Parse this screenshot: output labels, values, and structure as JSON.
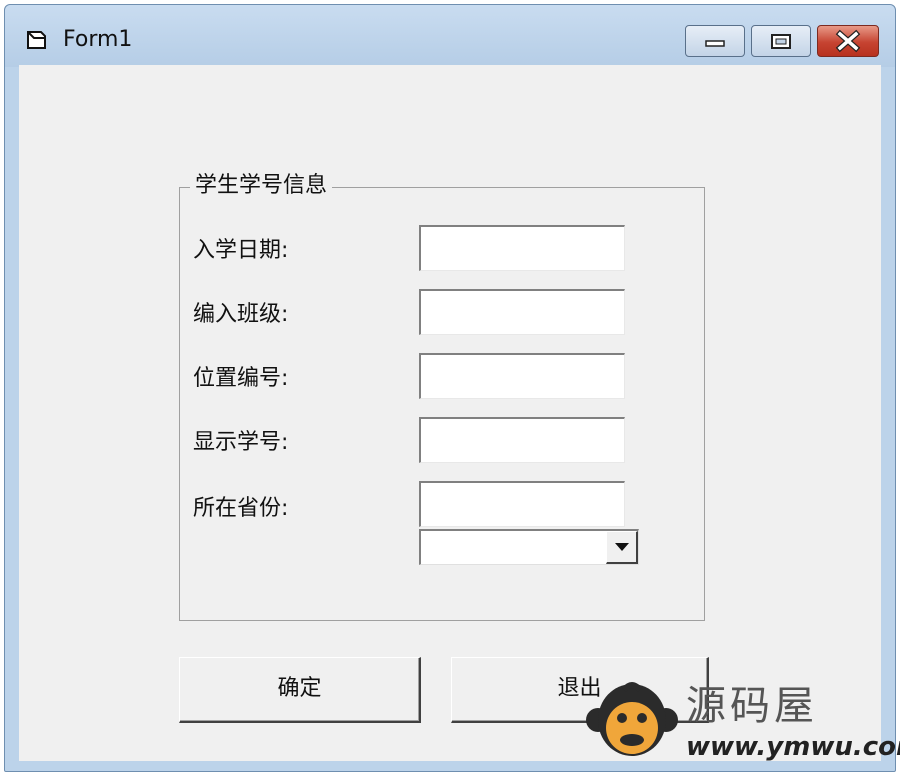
{
  "window": {
    "title": "Form1",
    "app_icon": "form-icon",
    "controls": {
      "minimize": "minimize-icon",
      "maximize": "maximize-icon",
      "close": "close-icon"
    }
  },
  "group": {
    "title": "学生学号信息",
    "fields": [
      {
        "label": "入学日期:",
        "value": ""
      },
      {
        "label": "编入班级:",
        "value": ""
      },
      {
        "label": "位置编号:",
        "value": ""
      },
      {
        "label": "显示学号:",
        "value": ""
      },
      {
        "label": "所在省份:",
        "value": ""
      }
    ],
    "combo_value": ""
  },
  "buttons": {
    "ok": "确定",
    "exit": "退出"
  },
  "watermark": {
    "name": "源码屋",
    "url": "www.ymwu.com"
  },
  "colors": {
    "titlebar": "#bcd3ea",
    "client": "#f0f0f0",
    "close_button": "#c64331"
  }
}
